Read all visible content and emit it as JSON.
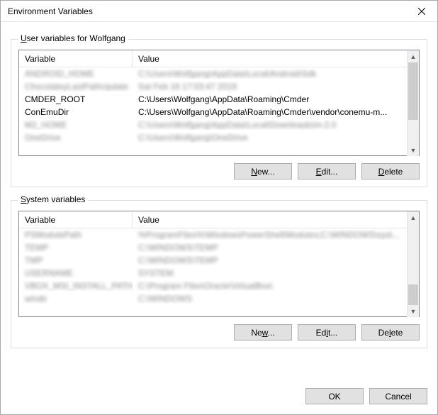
{
  "window": {
    "title": "Environment Variables"
  },
  "user_group": {
    "label_prefix": "U",
    "label_rest": "ser variables for Wolfgang",
    "columns": {
      "variable": "Variable",
      "value": "Value"
    },
    "rows": [
      {
        "variable": "ANDROID_HOME",
        "value": "C:\\Users\\Wolfgang\\AppData\\Local\\Android\\Sdk",
        "blurred": true
      },
      {
        "variable": "ChocolateyLastPathUpdate",
        "value": "Sat Feb 16 17:03:47 2019",
        "blurred": true
      },
      {
        "variable": "CMDER_ROOT",
        "value": "C:\\Users\\Wolfgang\\AppData\\Roaming\\Cmder",
        "blurred": false
      },
      {
        "variable": "ConEmuDir",
        "value": "C:\\Users\\Wolfgang\\AppData\\Roaming\\Cmder\\vendor\\conemu-m...",
        "blurred": false
      },
      {
        "variable": "M2_HOME",
        "value": "C:\\Users\\Wolfgang\\AppData\\Local\\Downloads\\m-2.0",
        "blurred": true
      },
      {
        "variable": "OneDrive",
        "value": "C:\\Users\\Wolfgang\\OneDrive",
        "blurred": true
      }
    ],
    "buttons": {
      "new": "New...",
      "edit": "Edit...",
      "delete": "Delete"
    }
  },
  "system_group": {
    "label_prefix": "S",
    "label_rest": "ystem variables",
    "columns": {
      "variable": "Variable",
      "value": "Value"
    },
    "rows": [
      {
        "variable": "PSModulePath",
        "value": "%ProgramFiles%\\WindowsPowerShell\\Modules;C:\\WINDOWS\\syst...",
        "blurred": true
      },
      {
        "variable": "TEMP",
        "value": "C:\\WINDOWS\\TEMP",
        "blurred": true
      },
      {
        "variable": "TMP",
        "value": "C:\\WINDOWS\\TEMP",
        "blurred": true
      },
      {
        "variable": "USERNAME",
        "value": "SYSTEM",
        "blurred": true
      },
      {
        "variable": "VBOX_MSI_INSTALL_PATH",
        "value": "C:\\Program Files\\Oracle\\VirtualBox\\",
        "blurred": true
      },
      {
        "variable": "windir",
        "value": "C:\\WINDOWS",
        "blurred": true
      }
    ],
    "buttons": {
      "new": "New...",
      "edit": "Edit...",
      "delete": "Delete"
    }
  },
  "footer": {
    "ok": "OK",
    "cancel": "Cancel"
  }
}
